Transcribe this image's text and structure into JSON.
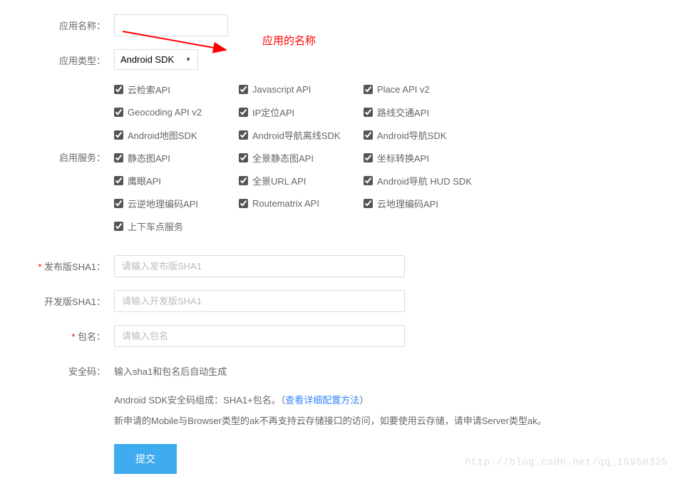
{
  "labels": {
    "appName": "应用名称：",
    "appType": "应用类型：",
    "enableServices": "启用服务：",
    "releaseSha1": "发布版SHA1：",
    "devSha1": "开发版SHA1：",
    "packageName": "包名：",
    "securityCode": "安全码："
  },
  "annotation": "应用的名称",
  "select": {
    "appType": "Android SDK"
  },
  "services": {
    "col1": [
      "云检索API",
      "Geocoding API v2",
      "Android地图SDK",
      "静态图API",
      "鹰眼API",
      "云逆地理编码API",
      "上下车点服务"
    ],
    "col2": [
      "Javascript API",
      "IP定位API",
      "Android导航离线SDK",
      "全景静态图API",
      "全景URL API",
      "Routematrix API"
    ],
    "col3": [
      "Place API v2",
      "路线交通API",
      "Android导航SDK",
      "坐标转换API",
      "Android导航 HUD SDK",
      "云地理编码API"
    ]
  },
  "placeholders": {
    "releaseSha1": "请输入发布版SHA1",
    "devSha1": "请输入开发版SHA1",
    "packageName": "请输入包名"
  },
  "securityCodeHint": "输入sha1和包名后自动生成",
  "notes": {
    "line1_pre": "Android SDK安全码组成：SHA1+包名。（",
    "line1_link": "查看详细配置方法",
    "line1_post": "）",
    "line2": "新申请的Mobile与Browser类型的ak不再支持云存储接口的访问，如要使用云存储，请申请Server类型ak。"
  },
  "submitLabel": "提交",
  "watermark": "http://blog.csdn.net/qq_15950325"
}
